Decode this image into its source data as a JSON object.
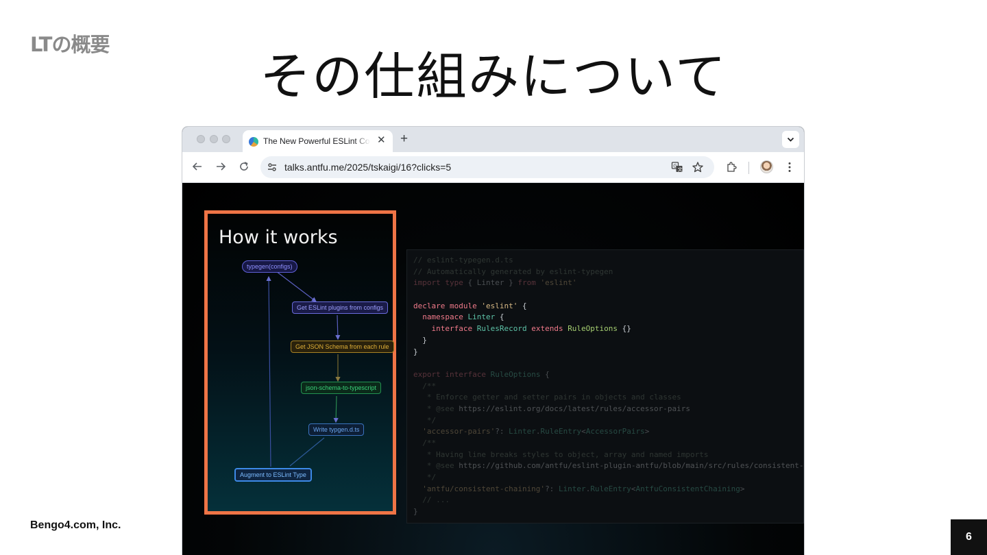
{
  "slide": {
    "section_label": "LTの概要",
    "title": "その仕組みについて",
    "company": "Bengo4.com, Inc.",
    "page_number": "6"
  },
  "browser": {
    "tab": {
      "title": "The New Powerful ESLint Config",
      "close_icon": "close-icon",
      "favicon": "site-favicon"
    },
    "new_tab_icon": "plus-icon",
    "toolbar": {
      "back_icon": "arrow-left-icon",
      "forward_icon": "arrow-right-icon",
      "reload_icon": "reload-icon",
      "site_info_icon": "tune-icon",
      "url": "talks.antfu.me/2025/tskaigi/16?clicks=5",
      "translate_icon": "translate-icon",
      "bookmark_icon": "star-icon",
      "extensions_icon": "puzzle-icon",
      "profile_icon": "avatar",
      "menu_icon": "kebab-menu-icon"
    }
  },
  "diagram": {
    "heading": "How it works",
    "nodes": [
      {
        "label": "typegen(configs)",
        "color": "#7b7be8"
      },
      {
        "label": "Get ESLint plugins from configs",
        "color": "#8c8ef2"
      },
      {
        "label": "Get JSON Schema from each rule",
        "color": "#d9a625"
      },
      {
        "label": "json-schema-to-typescript",
        "color": "#2fc46a"
      },
      {
        "label": "Write typgen.d.ts",
        "color": "#4a8fe0"
      },
      {
        "label": "Augment to ESLint Type",
        "color": "#5aa8ff"
      }
    ]
  },
  "code": {
    "lines": [
      [
        {
          "t": "// eslint-typegen.d.ts",
          "c": "c-cm"
        }
      ],
      [
        {
          "t": "// Automatically generated by eslint-typegen",
          "c": "c-cm"
        }
      ],
      [
        {
          "t": "import type ",
          "c": "c-kw"
        },
        {
          "t": "{ Linter } ",
          "c": "c-tx"
        },
        {
          "t": "from ",
          "c": "c-kw"
        },
        {
          "t": "'eslint'",
          "c": "c-st"
        }
      ],
      [
        {
          "t": "",
          "c": "c-tx"
        }
      ],
      [
        {
          "t": "declare module ",
          "c": "c-kw"
        },
        {
          "t": "'eslint'",
          "c": "c-st"
        },
        {
          "t": " {",
          "c": "c-tx"
        }
      ],
      [
        {
          "t": "  namespace ",
          "c": "c-kw"
        },
        {
          "t": "Linter",
          "c": "c-ty"
        },
        {
          "t": " {",
          "c": "c-tx"
        }
      ],
      [
        {
          "t": "    interface ",
          "c": "c-kw"
        },
        {
          "t": "RulesRecord ",
          "c": "c-ty"
        },
        {
          "t": "extends ",
          "c": "c-kw"
        },
        {
          "t": "RuleOptions",
          "c": "c-fn"
        },
        {
          "t": " {}",
          "c": "c-tx"
        }
      ],
      [
        {
          "t": "  }",
          "c": "c-tx"
        }
      ],
      [
        {
          "t": "}",
          "c": "c-tx"
        }
      ],
      [
        {
          "t": "",
          "c": "c-tx"
        }
      ],
      [
        {
          "t": "export interface ",
          "c": "c-kw"
        },
        {
          "t": "RuleOptions",
          "c": "c-ty"
        },
        {
          "t": " {",
          "c": "c-tx"
        }
      ],
      [
        {
          "t": "  /**",
          "c": "c-cm"
        }
      ],
      [
        {
          "t": "   * Enforce getter and setter pairs in objects and classes",
          "c": "c-cm"
        }
      ],
      [
        {
          "t": "   * @see ",
          "c": "c-cm"
        },
        {
          "t": "https://eslint.org/docs/latest/rules/accessor-pairs",
          "c": "c-lk"
        }
      ],
      [
        {
          "t": "   */",
          "c": "c-cm"
        }
      ],
      [
        {
          "t": "  'accessor-pairs'",
          "c": "c-st"
        },
        {
          "t": "?: ",
          "c": "c-tx"
        },
        {
          "t": "Linter",
          "c": "c-ty"
        },
        {
          "t": ".",
          "c": "c-tx"
        },
        {
          "t": "RuleEntry",
          "c": "c-ty"
        },
        {
          "t": "<",
          "c": "c-tx"
        },
        {
          "t": "AccessorPairs",
          "c": "c-ty"
        },
        {
          "t": ">",
          "c": "c-tx"
        }
      ],
      [
        {
          "t": "  /**",
          "c": "c-cm"
        }
      ],
      [
        {
          "t": "   * Having line breaks styles to object, array and named imports",
          "c": "c-cm"
        }
      ],
      [
        {
          "t": "   * @see ",
          "c": "c-cm"
        },
        {
          "t": "https://github.com/antfu/eslint-plugin-antfu/blob/main/src/rules/consistent-",
          "c": "c-lk"
        }
      ],
      [
        {
          "t": "   */",
          "c": "c-cm"
        }
      ],
      [
        {
          "t": "  'antfu/consistent-chaining'",
          "c": "c-st"
        },
        {
          "t": "?: ",
          "c": "c-tx"
        },
        {
          "t": "Linter",
          "c": "c-ty"
        },
        {
          "t": ".",
          "c": "c-tx"
        },
        {
          "t": "RuleEntry",
          "c": "c-ty"
        },
        {
          "t": "<",
          "c": "c-tx"
        },
        {
          "t": "AntfuConsistentChaining",
          "c": "c-ty"
        },
        {
          "t": ">",
          "c": "c-tx"
        }
      ],
      [
        {
          "t": "  // ...",
          "c": "c-cm"
        }
      ],
      [
        {
          "t": "}",
          "c": "c-tx"
        }
      ]
    ],
    "highlighted_lines": [
      4,
      5,
      6,
      7,
      8
    ]
  }
}
